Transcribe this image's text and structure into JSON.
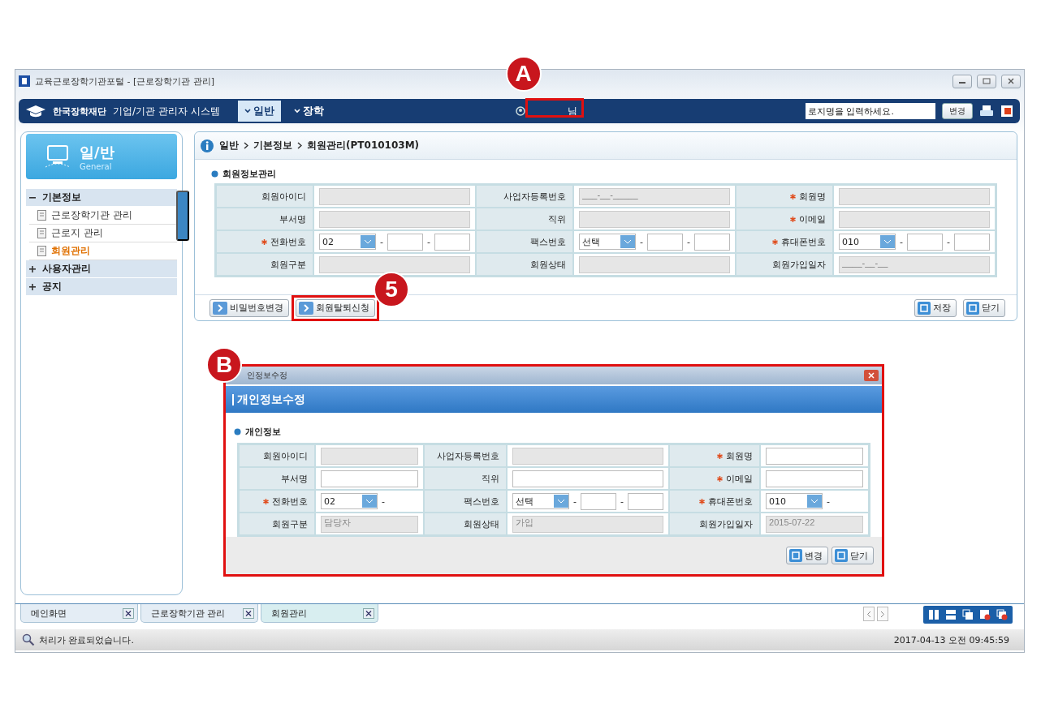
{
  "window": {
    "title": "교육근로장학기관포털 - [근로장학기관 관리]"
  },
  "header": {
    "logo": "한국장학재단",
    "system_title": "기업/기관 관리자 시스템",
    "menus": [
      {
        "label": "일반",
        "selected": true
      },
      {
        "label": "장학",
        "selected": false
      }
    ],
    "user_suffix": "님",
    "search": {
      "placeholder": "로지명을 입력하세요."
    },
    "change_button": "변경"
  },
  "sidebar": {
    "title": "일/반",
    "subtitle": "General",
    "groups": [
      {
        "label": "기본정보",
        "expanded": true,
        "children": [
          {
            "label": "근로장학기관 관리",
            "selected": false
          },
          {
            "label": "근로지 관리",
            "selected": false
          },
          {
            "label": "회원관리",
            "selected": true
          }
        ]
      },
      {
        "label": "사용자관리",
        "expanded": false
      },
      {
        "label": "공지",
        "expanded": false
      }
    ]
  },
  "breadcrumb": [
    "일반",
    "기본정보",
    "회원관리(PT010103M)"
  ],
  "section_title": "회원정보관리",
  "form": {
    "rows": [
      [
        {
          "label": "회원아이디",
          "required": false,
          "kind": "text",
          "disabled": true
        },
        {
          "label": "사업자등록번호",
          "required": false,
          "kind": "text",
          "disabled": true,
          "placeholder": "___-__-_____"
        },
        {
          "label": "회원명",
          "required": true,
          "kind": "text",
          "disabled": true
        }
      ],
      [
        {
          "label": "부서명",
          "required": false,
          "kind": "text",
          "disabled": true
        },
        {
          "label": "직위",
          "required": false,
          "kind": "text",
          "disabled": true
        },
        {
          "label": "이메일",
          "required": true,
          "kind": "text",
          "disabled": true
        }
      ],
      [
        {
          "label": "전화번호",
          "required": true,
          "kind": "phone",
          "select": "02",
          "separator": "-"
        },
        {
          "label": "팩스번호",
          "required": false,
          "kind": "phone",
          "select": "선택",
          "separator": "-"
        },
        {
          "label": "휴대폰번호",
          "required": true,
          "kind": "phone",
          "select": "010",
          "separator": "-"
        }
      ],
      [
        {
          "label": "회원구분",
          "required": false,
          "kind": "text",
          "disabled": true
        },
        {
          "label": "회원상태",
          "required": false,
          "kind": "text",
          "disabled": true
        },
        {
          "label": "회원가입일자",
          "required": false,
          "kind": "text",
          "disabled": true,
          "placeholder": "____-__-__"
        }
      ]
    ]
  },
  "left_buttons": [
    "비밀번호변경",
    "회원탈퇴신청"
  ],
  "right_buttons": [
    "저장",
    "닫기"
  ],
  "dialog": {
    "window_title": "인정보수정",
    "title": "개인정보수정",
    "section_title": "개인정보",
    "rows": [
      [
        {
          "label": "회원아이디",
          "required": false,
          "kind": "text",
          "disabled": true
        },
        {
          "label": "사업자등록번호",
          "required": false,
          "kind": "text",
          "disabled": true
        },
        {
          "label": "회원명",
          "required": true,
          "kind": "text",
          "disabled": false
        }
      ],
      [
        {
          "label": "부서명",
          "required": false,
          "kind": "text",
          "disabled": false
        },
        {
          "label": "직위",
          "required": false,
          "kind": "text",
          "disabled": false
        },
        {
          "label": "이메일",
          "required": true,
          "kind": "text",
          "disabled": false
        }
      ],
      [
        {
          "label": "전화번호",
          "required": true,
          "kind": "phone_short",
          "select": "02",
          "separator": "-"
        },
        {
          "label": "팩스번호",
          "required": false,
          "kind": "phone",
          "select": "선택",
          "separator": "-"
        },
        {
          "label": "휴대폰번호",
          "required": true,
          "kind": "phone_short",
          "select": "010",
          "separator": "-"
        }
      ],
      [
        {
          "label": "회원구분",
          "required": false,
          "kind": "text",
          "disabled": true,
          "value": "담당자"
        },
        {
          "label": "회원상태",
          "required": false,
          "kind": "text",
          "disabled": true,
          "value": "가입"
        },
        {
          "label": "회원가입일자",
          "required": false,
          "kind": "text",
          "disabled": true,
          "value": "2015-07-22"
        }
      ]
    ],
    "buttons": [
      "변경",
      "닫기"
    ]
  },
  "tabs": [
    {
      "label": "메인화면",
      "selected": false
    },
    {
      "label": "근로장학기관 관리",
      "selected": false
    },
    {
      "label": "회원관리",
      "selected": true
    }
  ],
  "status_bar": {
    "message": "처리가 완료되었습니다.",
    "datetime": "2017-04-13 오전 09:45:59"
  },
  "annotations": [
    {
      "label": "A"
    },
    {
      "label": "5"
    },
    {
      "label": "B"
    }
  ]
}
